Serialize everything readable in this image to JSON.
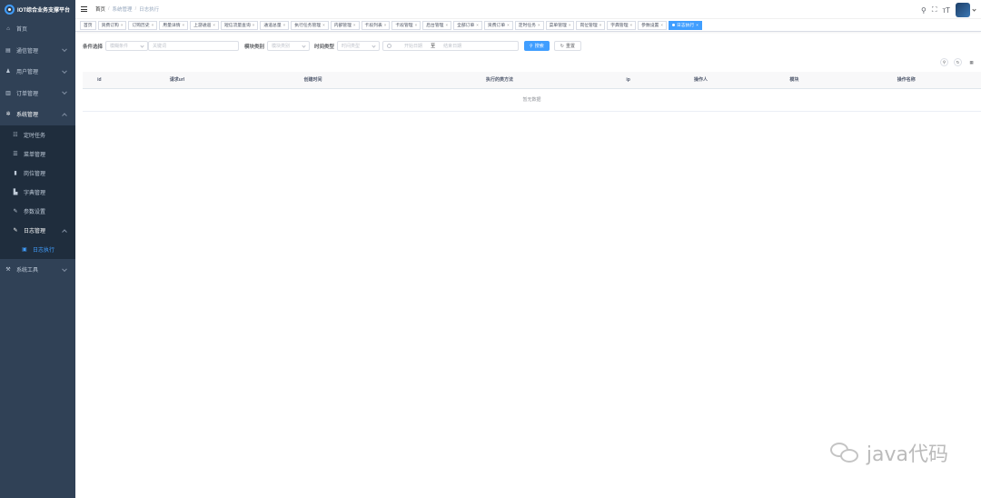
{
  "app": {
    "title": "IOT综合业务支撑平台"
  },
  "sidebar": {
    "items": [
      {
        "label": "首页",
        "icon": "home-icon"
      },
      {
        "label": "通信管理",
        "icon": "cards-icon"
      },
      {
        "label": "用户管理",
        "icon": "user-icon"
      },
      {
        "label": "订单管理",
        "icon": "chart-icon"
      },
      {
        "label": "系统管理",
        "icon": "gear-icon"
      }
    ],
    "system_children": [
      {
        "label": "定时任务",
        "icon": "timer-icon"
      },
      {
        "label": "菜单管理",
        "icon": "menu-list-icon"
      },
      {
        "label": "岗位管理",
        "icon": "post-icon"
      },
      {
        "label": "字典管理",
        "icon": "dict-icon"
      },
      {
        "label": "参数设置",
        "icon": "edit-icon"
      },
      {
        "label": "日志管理",
        "icon": "log-icon"
      }
    ],
    "log_children": [
      {
        "label": "日志执行",
        "icon": "log-run-icon"
      }
    ],
    "tools": {
      "label": "系统工具",
      "icon": "tools-icon"
    }
  },
  "breadcrumb": {
    "home": "首页",
    "parent": "系统管理",
    "current": "日志执行"
  },
  "tags": [
    {
      "label": "首页",
      "closable": false
    },
    {
      "label": "资费订购",
      "closable": true
    },
    {
      "label": "订购历史",
      "closable": true
    },
    {
      "label": "用量详情",
      "closable": true
    },
    {
      "label": "上游通道",
      "closable": true
    },
    {
      "label": "短信流量查询",
      "closable": true
    },
    {
      "label": "通道总量",
      "closable": true
    },
    {
      "label": "执行任务管理",
      "closable": true
    },
    {
      "label": "内部管理",
      "closable": true
    },
    {
      "label": "卡段列表",
      "closable": true
    },
    {
      "label": "卡段管理",
      "closable": true
    },
    {
      "label": "后台管理",
      "closable": true
    },
    {
      "label": "全部订单",
      "closable": true
    },
    {
      "label": "资费订单",
      "closable": true
    },
    {
      "label": "定时任务",
      "closable": true
    },
    {
      "label": "菜单管理",
      "closable": true
    },
    {
      "label": "岗位管理",
      "closable": true
    },
    {
      "label": "字典管理",
      "closable": true
    },
    {
      "label": "参数设置",
      "closable": true
    },
    {
      "label": "日志执行",
      "closable": true,
      "active": true
    }
  ],
  "filters": {
    "condition_label": "条件选择",
    "condition_select_placeholder": "模糊条件",
    "keyword_placeholder": "关键词",
    "module_label": "模块类别",
    "module_placeholder": "模块类别",
    "time_label": "时间类型",
    "time_placeholder": "时间类型",
    "start_placeholder": "开始日期",
    "range_separator": "至",
    "end_placeholder": "结束日期",
    "search_label": "搜索",
    "reset_label": "重置"
  },
  "table": {
    "columns": [
      "id",
      "请求url",
      "创建时间",
      "执行的类方法",
      "ip",
      "操作人",
      "模块",
      "操作名称"
    ],
    "empty_text": "暂无数据"
  },
  "watermark": {
    "text": "java代码"
  },
  "colors": {
    "sidebar_bg": "#304156",
    "primary": "#409eff"
  }
}
